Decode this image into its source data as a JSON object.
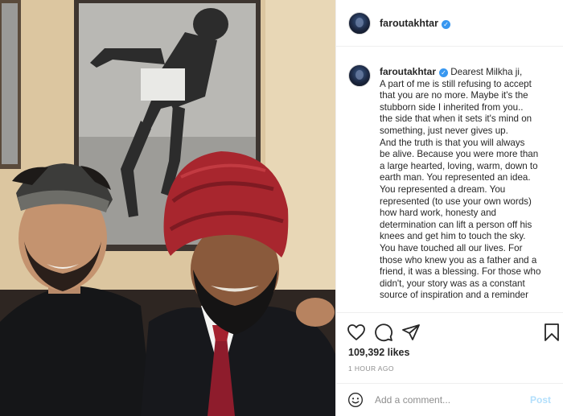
{
  "post": {
    "username": "faroutakhtar",
    "verified_mark": "✓",
    "caption_lines": [
      "Dearest Milkha ji,",
      "A part of me is still refusing to accept",
      "that you are no more. Maybe it's the",
      "stubborn side I inherited from you..",
      "the side that when it sets it's mind on",
      "something, just never gives up.",
      "And the truth is that you will always",
      "be alive. Because you were more than",
      "a large hearted, loving, warm, down to",
      "earth man. You represented an idea.",
      "You represented a dream. You",
      "represented (to use your own words)",
      "how hard work, honesty and",
      "determination can lift a person off his",
      "knees and get him to touch the sky.",
      "You have touched all our lives. For",
      "those who knew you as a father and a",
      "friend, it was a blessing. For those who",
      "didn't, your story was as a constant",
      "source of inspiration and a reminder"
    ],
    "likes": "109,392 likes",
    "time_ago": "1 HOUR AGO"
  },
  "actions": {
    "like_icon": "heart-icon",
    "comment_icon": "comment-icon",
    "share_icon": "paper-plane-icon",
    "save_icon": "bookmark-icon"
  },
  "comment_box": {
    "placeholder": "Add a comment...",
    "post_label": "Post",
    "emoji_icon": "smiley-icon"
  },
  "colors": {
    "verified_blue": "#3897f0",
    "post_disabled_blue": "#b2dffc",
    "muted_gray": "#8e8e8e",
    "turban_red": "#a8262e"
  }
}
